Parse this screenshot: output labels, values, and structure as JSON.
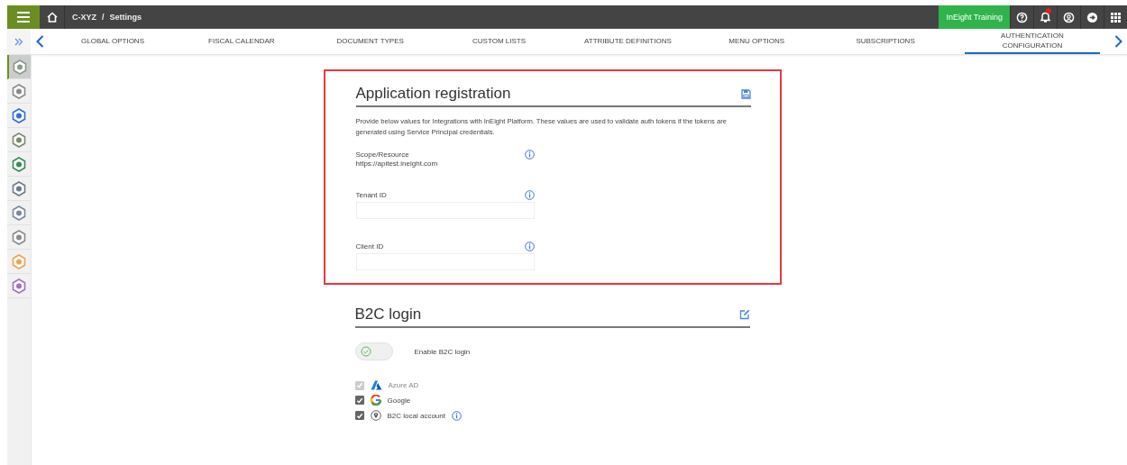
{
  "breadcrumb": {
    "company": "C-XYZ",
    "separator": "/",
    "page": "Settings"
  },
  "top_bar": {
    "environment": "InEight Training",
    "notification_badge": true
  },
  "tabs": [
    {
      "label": "GLOBAL OPTIONS",
      "selected": false
    },
    {
      "label": "FISCAL CALENDAR",
      "selected": false
    },
    {
      "label": "DOCUMENT TYPES",
      "selected": false
    },
    {
      "label": "CUSTOM LISTS",
      "selected": false
    },
    {
      "label": "ATTRIBUTE DEFINITIONS",
      "selected": false
    },
    {
      "label": "MENU OPTIONS",
      "selected": false
    },
    {
      "label": "SUBSCRIPTIONS",
      "selected": false
    },
    {
      "label": "AUTHENTICATION CONFIGURATION",
      "selected": true
    }
  ],
  "sidebar": {
    "items": [
      {
        "color": "#8a9a8a",
        "selected": true
      },
      {
        "color": "#8a8a8a",
        "selected": false
      },
      {
        "color": "#2f6fd6",
        "selected": false
      },
      {
        "color": "#7a8a6a",
        "selected": false
      },
      {
        "color": "#3a8a5a",
        "selected": false
      },
      {
        "color": "#6a7a8a",
        "selected": false
      },
      {
        "color": "#7a8a9a",
        "selected": false
      },
      {
        "color": "#8a8a8a",
        "selected": false
      },
      {
        "color": "#f0a050",
        "selected": false
      },
      {
        "color": "#a070c0",
        "selected": false
      }
    ]
  },
  "app_registration": {
    "title": "Application registration",
    "description": "Provide below values for Integrations with InEight Platform. These values are used to validate auth tokens if the tokens are generated using Service Principal credentials.",
    "fields": [
      {
        "kind": "readonly",
        "label": "Scope/Resource",
        "value": "https://apitest.ineight.com"
      },
      {
        "kind": "input",
        "label": "Tenant ID"
      },
      {
        "kind": "input",
        "label": "Client ID"
      }
    ]
  },
  "b2c_login": {
    "title": "B2C login",
    "toggle": {
      "label": "Enable B2C login",
      "on": false
    },
    "providers": [
      {
        "kind": "azure",
        "label": "Azure AD",
        "checked": true,
        "disabled": true,
        "info": false
      },
      {
        "kind": "google",
        "label": "Google",
        "checked": true,
        "disabled": false,
        "info": false
      },
      {
        "kind": "local",
        "label": "B2C local account",
        "checked": true,
        "disabled": false,
        "info": true
      }
    ]
  }
}
